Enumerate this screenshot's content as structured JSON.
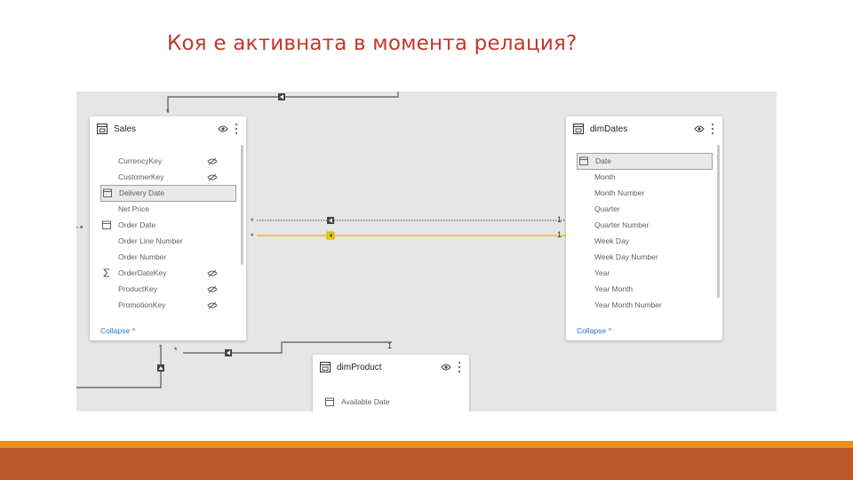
{
  "slide": {
    "title": "Коя е активната в момента релация?"
  },
  "colors": {
    "active_relation": "#f2c811",
    "inactive_relation": "#7a7a7a",
    "footer_orange": "#e88e1c",
    "footer_rust": "#bb5a2a"
  },
  "sales": {
    "title": "Sales",
    "fields": [
      "CurrencyKey",
      "CustomerKey",
      "Delivery Date",
      "Net Price",
      "Order Date",
      "Order Line Number",
      "Order Number",
      "OrderDateKey",
      "ProductKey",
      "PromotionKey"
    ],
    "collapse": "Collapse"
  },
  "dimdates": {
    "title": "dimDates",
    "fields": [
      "Date",
      "Month",
      "Month Number",
      "Quarter",
      "Quarter Number",
      "Week Day",
      "Week Day Number",
      "Year",
      "Year Month",
      "Year Month Number"
    ],
    "collapse": "Collapse"
  },
  "dimproduct": {
    "title": "dimProduct",
    "fields": [
      "Available Date"
    ]
  },
  "relations": {
    "many": "*",
    "one": "1"
  }
}
